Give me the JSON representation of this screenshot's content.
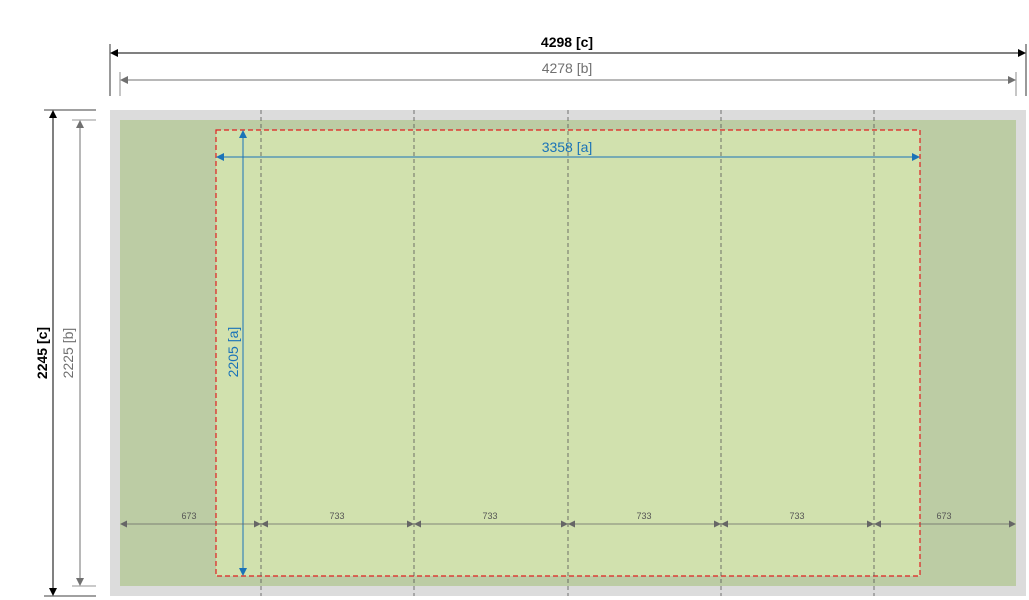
{
  "dimensions": {
    "c_width": "4298 [c]",
    "b_width": "4278 [b]",
    "a_width": "3358 [a]",
    "c_height": "2245 [c]",
    "b_height": "2225 [b]",
    "a_height": "2205 [a]"
  },
  "segments": [
    "673",
    "733",
    "733",
    "733",
    "733",
    "673"
  ],
  "colors": {
    "outer_frame": "#dcdcdc",
    "panel": "#bccca4",
    "active_area": "#d1e1ae",
    "dashed_border": "#e02020",
    "dim_c": "#000000",
    "dim_b": "#707070",
    "dim_a": "#1a73b8",
    "segment_dim": "#666666"
  }
}
